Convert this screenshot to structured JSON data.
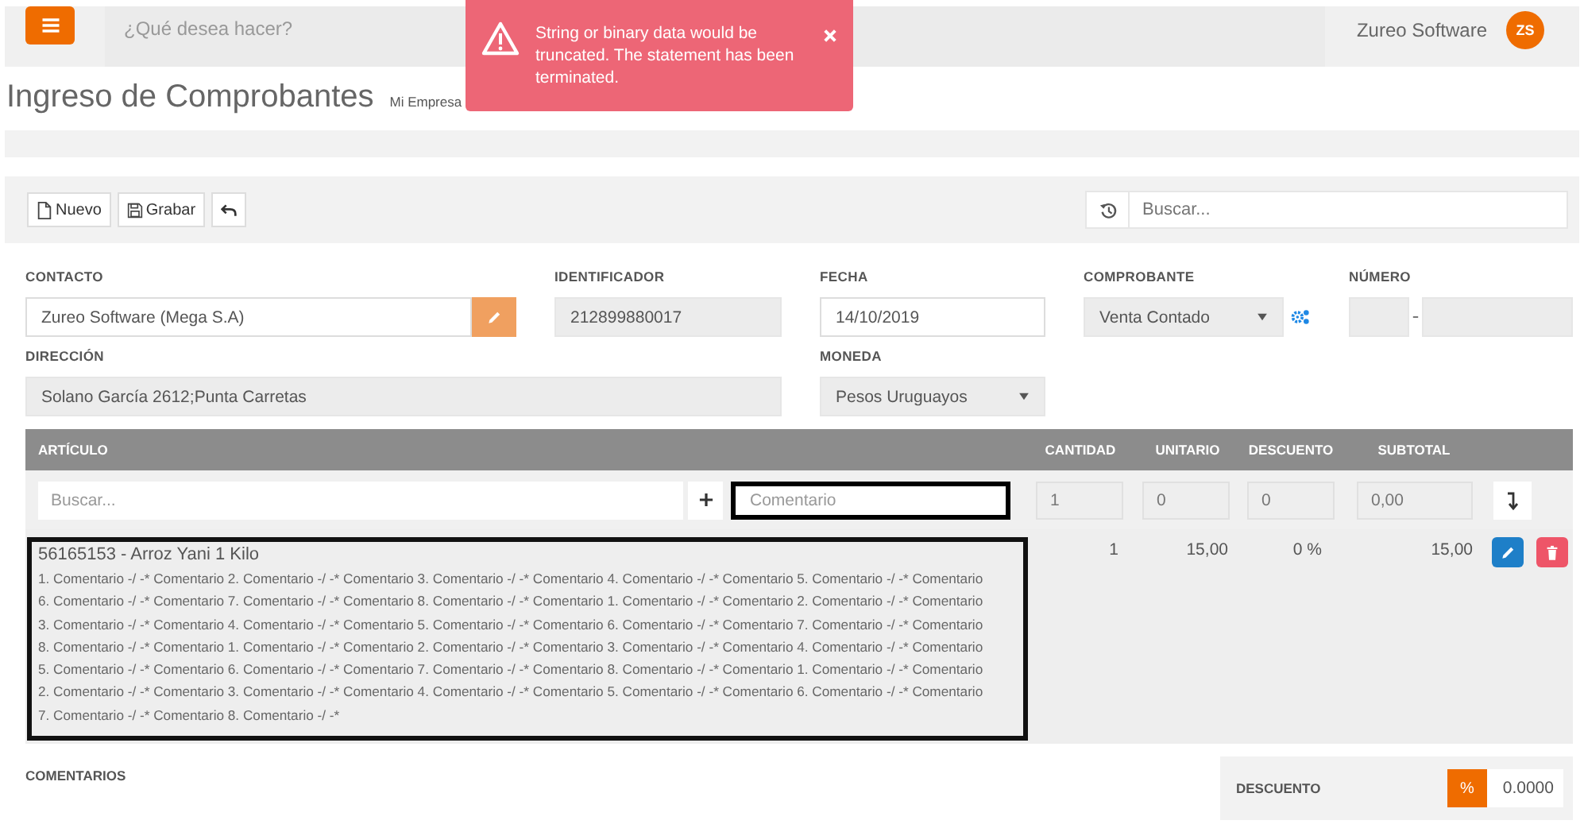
{
  "topbar": {
    "search_placeholder": "¿Qué desea hacer?",
    "user_name": "Zureo Software",
    "avatar_initials": "ZS"
  },
  "toast": {
    "message": "String or binary data would be truncated. The statement has been terminated."
  },
  "page": {
    "title": "Ingreso de Comprobantes",
    "breadcrumb": [
      "Mi Empresa"
    ]
  },
  "toolbar": {
    "buttons": [
      {
        "kind": "new",
        "label": "Nuevo"
      },
      {
        "kind": "save",
        "label": "Grabar"
      },
      {
        "kind": "undo"
      }
    ],
    "search_placeholder": "Buscar..."
  },
  "form": {
    "fields": [
      {
        "kind": "edit",
        "label": "CONTACTO",
        "value": "Zureo Software (Mega S.A)"
      },
      {
        "kind": "readonly",
        "label": "IDENTIFICADOR",
        "value": "212899880017"
      },
      {
        "kind": "input",
        "label": "FECHA",
        "value": "14/10/2019"
      },
      {
        "kind": "select_settings",
        "label": "COMPROBANTE",
        "value": "Venta Contado"
      },
      {
        "kind": "split",
        "label": "NÚMERO"
      },
      {
        "kind": "readonly_wide",
        "label": "DIRECCIÓN",
        "value": "Solano García 2612;Punta Carretas"
      },
      {
        "kind": "select",
        "label": "MONEDA",
        "value": "Pesos Uruguayos"
      }
    ]
  },
  "table": {
    "columns": [
      "ARTÍCULO",
      "CANTIDAD",
      "UNITARIO",
      "DESCUENTO",
      "SUBTOTAL"
    ],
    "entry_row": {
      "article_placeholder": "Buscar...",
      "comment_placeholder": "Comentario",
      "cantidad": "1",
      "unitario": "0",
      "descuento": "0",
      "subtotal": "0,00"
    },
    "rows": [
      {
        "article": "56165153 - Arroz Yani 1 Kilo",
        "comment": "1. Comentario -/ -* Comentario 2. Comentario -/ -* Comentario 3. Comentario -/ -* Comentario 4. Comentario -/ -* Comentario 5. Comentario -/ -* Comentario 6. Comentario -/ -* Comentario 7. Comentario -/ -* Comentario 8. Comentario -/ -* Comentario 1. Comentario -/ -* Comentario 2. Comentario -/ -* Comentario 3. Comentario -/ -* Comentario 4. Comentario -/ -* Comentario 5. Comentario -/ -* Comentario 6. Comentario -/ -* Comentario 7. Comentario -/ -* Comentario 8. Comentario -/ -* Comentario 1. Comentario -/ -* Comentario 2. Comentario -/ -* Comentario 3. Comentario -/ -* Comentario 4. Comentario -/ -* Comentario 5. Comentario -/ -* Comentario 6. Comentario -/ -* Comentario 7. Comentario -/ -* Comentario 8. Comentario -/ -* Comentario 1. Comentario -/ -* Comentario 2. Comentario -/ -* Comentario 3. Comentario -/ -* Comentario 4. Comentario -/ -* Comentario 5. Comentario -/ -* Comentario 6. Comentario -/ -* Comentario 7. Comentario -/ -* Comentario 8. Comentario -/ -*",
        "cantidad": "1",
        "unitario": "15,00",
        "descuento": "0 %",
        "subtotal": "15,00"
      }
    ]
  },
  "footer": {
    "comments_label": "COMENTARIOS",
    "discount_label": "DESCUENTO",
    "discount_button": "%",
    "discount_value": "0.0000"
  }
}
